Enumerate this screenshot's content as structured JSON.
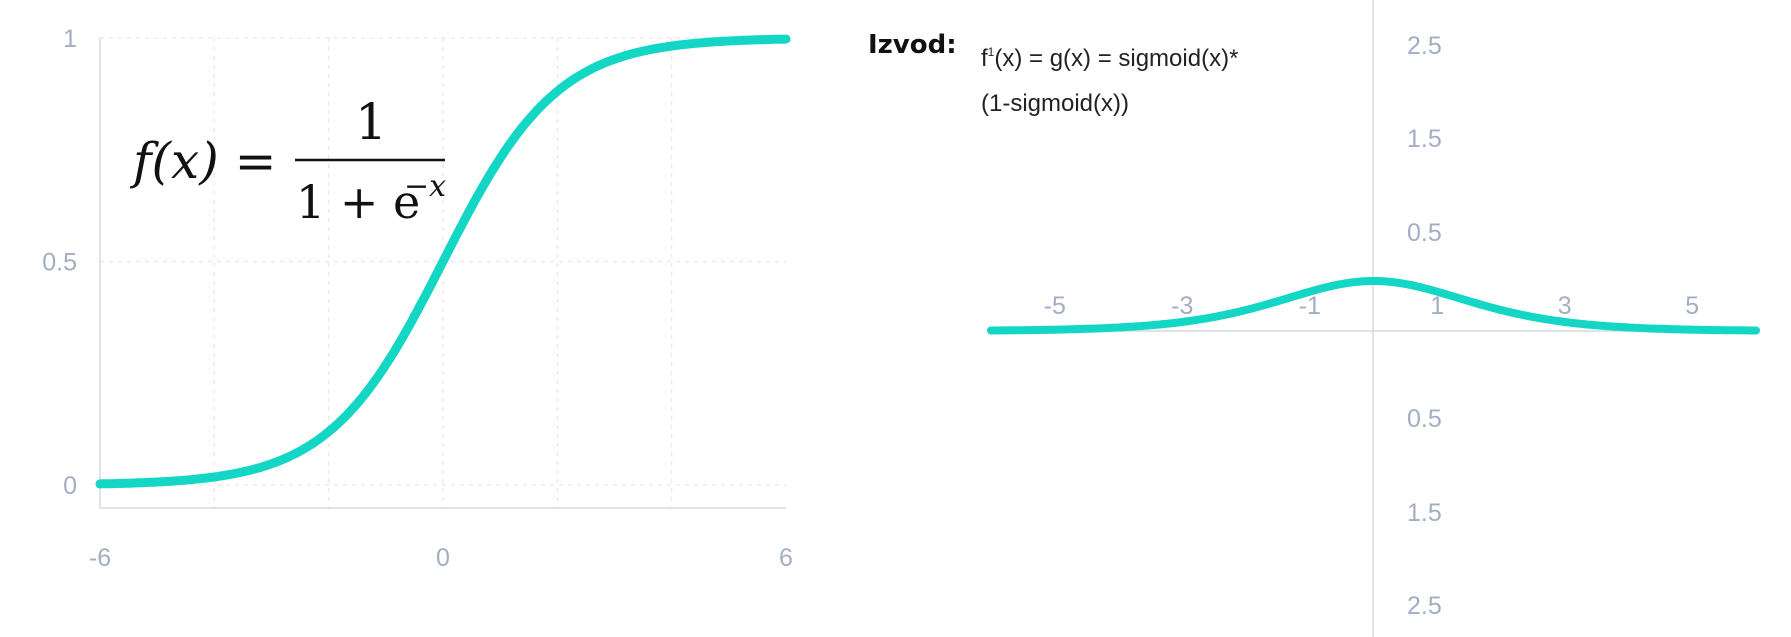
{
  "chart_data": [
    {
      "type": "line",
      "function": "sigmoid",
      "xlim": [
        -6,
        6
      ],
      "ylim": [
        0,
        1
      ],
      "x_ticks": [
        "-6",
        "0",
        "6"
      ],
      "y_ticks": [
        "1",
        "0.5",
        "0"
      ],
      "grid": true,
      "line_color": "#14d6c4",
      "formula": {
        "lhs": "f(x) =",
        "numerator": "1",
        "denominator": "1 + e",
        "exponent": "−x"
      }
    },
    {
      "type": "line",
      "function": "sigmoid derivative",
      "xlim": [
        -6,
        6
      ],
      "x_ticks": [
        "-5",
        "-3",
        "-1",
        "1",
        "3",
        "5"
      ],
      "y_ticks_above": [
        "2.5",
        "1.5",
        "0.5"
      ],
      "y_ticks_below": [
        "0.5",
        "1.5",
        "2.5"
      ],
      "line_color": "#14d6c4"
    }
  ],
  "izvod": {
    "label": "Izvod:",
    "formula_pre": "f",
    "formula_sup": "1",
    "formula_line1": "(x) = g(x) = sigmoid(x)*",
    "formula_line2": "(1-sigmoid(x))"
  }
}
